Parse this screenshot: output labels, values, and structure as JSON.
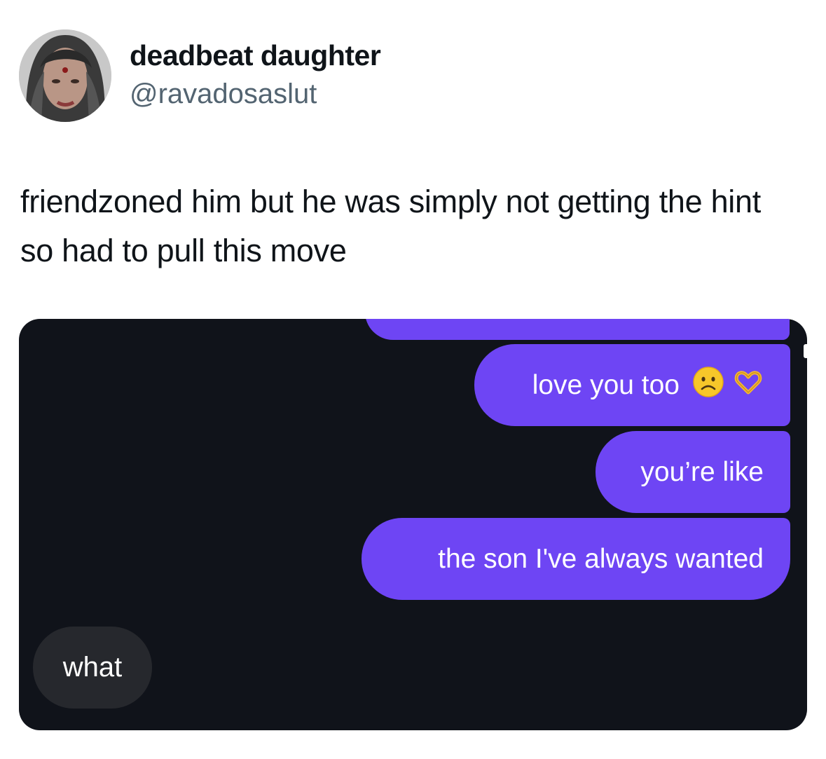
{
  "tweet": {
    "display_name": "deadbeat daughter",
    "handle": "@ravadosaslut",
    "text": "friendzoned him but he was simply not getting the hint so had to pull this move"
  },
  "chat": {
    "messages_sent": [
      {
        "text": "love you too",
        "icons": [
          "frowning-face-icon",
          "heart-hands-icon"
        ]
      },
      {
        "text": "you’re like"
      },
      {
        "text": "the son I've always wanted"
      }
    ],
    "message_received": {
      "text": "what"
    }
  },
  "colors": {
    "chat_background": "#10131a",
    "sent_bubble": "#6e45f4",
    "received_bubble": "#26282d",
    "handle_gray": "#536471"
  }
}
